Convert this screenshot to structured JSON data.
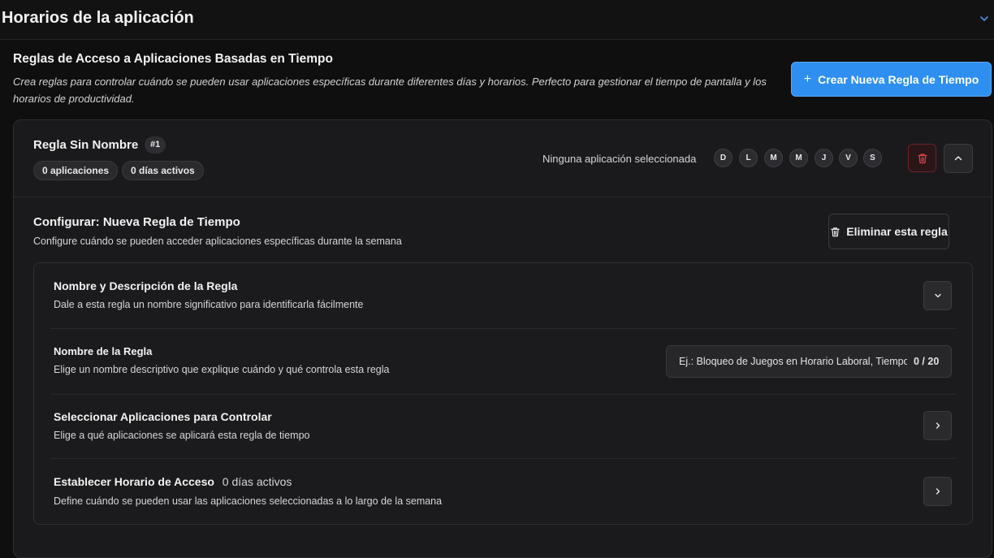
{
  "header": {
    "title": "Horarios de la aplicación"
  },
  "section": {
    "title": "Reglas de Acceso a Aplicaciones Basadas en Tiempo",
    "description": "Crea reglas para controlar cuándo se pueden usar aplicaciones específicas durante diferentes días y horarios. Perfecto para gestionar el tiempo de pantalla y los horarios de productividad.",
    "create_button": "Crear Nueva Regla de Tiempo"
  },
  "rule": {
    "name": "Regla Sin Nombre",
    "number": "#1",
    "apps_badge": "0 aplicaciones",
    "days_badge": "0 días activos",
    "no_apps_text": "Ninguna aplicación seleccionada",
    "days": [
      "D",
      "L",
      "M",
      "M",
      "J",
      "V",
      "S"
    ]
  },
  "config": {
    "title": "Configurar: Nueva Regla de Tiempo",
    "description": "Configure cuándo se pueden acceder aplicaciones específicas durante la semana",
    "delete_button": "Eliminar esta regla",
    "sections": {
      "name_desc": {
        "title": "Nombre y Descripción de la Regla",
        "description": "Dale a esta regla un nombre significativo para identificarla fácilmente"
      },
      "rule_name": {
        "title": "Nombre de la Regla",
        "description": "Elige un nombre descriptivo que explique cuándo y qué controla esta regla",
        "placeholder": "Ej.: Bloqueo de Juegos en Horario Laboral, Tiempo de Estudio",
        "value": "",
        "counter": "0 / 20"
      },
      "apps": {
        "title": "Seleccionar Aplicaciones para Controlar",
        "description": "Elige a qué aplicaciones se aplicará esta regla de tiempo"
      },
      "schedule": {
        "title": "Establecer Horario de Acceso",
        "status": "0 días activos",
        "description": "Define cuándo se pueden usar las aplicaciones seleccionadas a lo largo de la semana"
      }
    }
  },
  "colors": {
    "background": "#0f0f10",
    "card": "#1a1a1c",
    "accent": "#2e8ff0",
    "danger": "#e0444e"
  },
  "icons": {
    "header_toggle": "chevron-down-icon",
    "create": "plus-icon",
    "delete_rule": "trash-icon",
    "collapse": "chevron-up-icon",
    "expand_section": "chevron-down-icon",
    "open_section": "chevron-right-icon"
  }
}
